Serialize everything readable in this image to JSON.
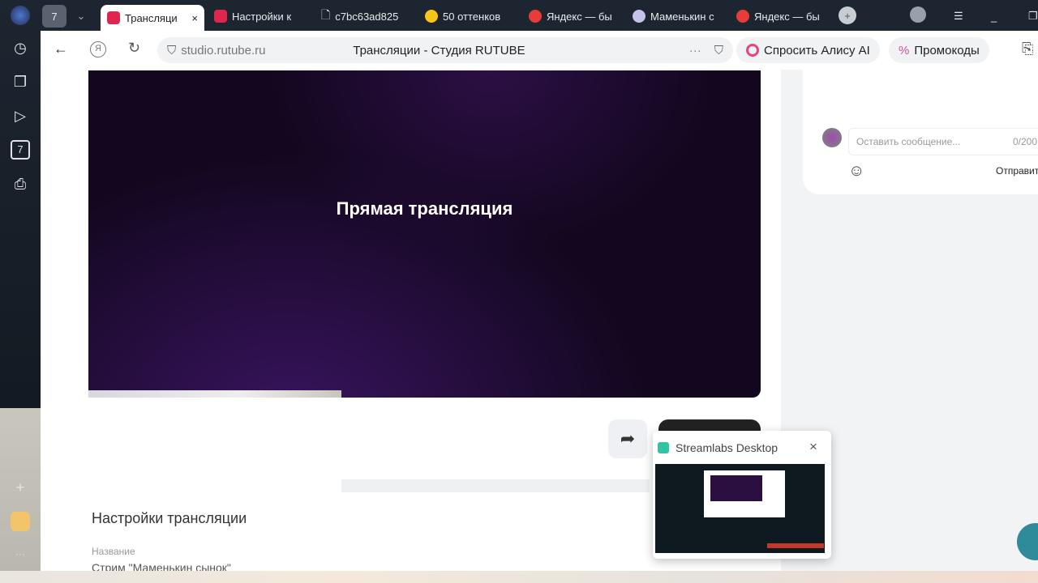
{
  "browser": {
    "tab_counter": "7",
    "tabs": [
      {
        "label": "Трансляци",
        "color": "#e0264e",
        "active": true
      },
      {
        "label": "Настройки к",
        "color": "#e0264e"
      },
      {
        "label": "c7bc63ad825",
        "color": "#ffffff"
      },
      {
        "label": "50 оттенков",
        "color": "#f5c518"
      },
      {
        "label": "Яндекс — бы",
        "color": "#e83b3b"
      },
      {
        "label": "Маменькин с",
        "color": "#c7c2e8"
      },
      {
        "label": "Яндекс — бы",
        "color": "#e83b3b"
      }
    ],
    "url": "studio.rutube.ru",
    "page_title": "Трансляции - Студия RUTUBE",
    "alice_label": "Спросить Алису AI",
    "promo_label": "Промокоды"
  },
  "video": {
    "title": "Прямая трансляция"
  },
  "chat": {
    "placeholder": "Оставить сообщение...",
    "counter": "0/200",
    "send_label": "Отправить"
  },
  "settings": {
    "heading": "Настройки трансляции",
    "name_label": "Название",
    "name_value": "Стрим \"Маменькин сынок\""
  },
  "popup": {
    "title": "Streamlabs Desktop"
  }
}
